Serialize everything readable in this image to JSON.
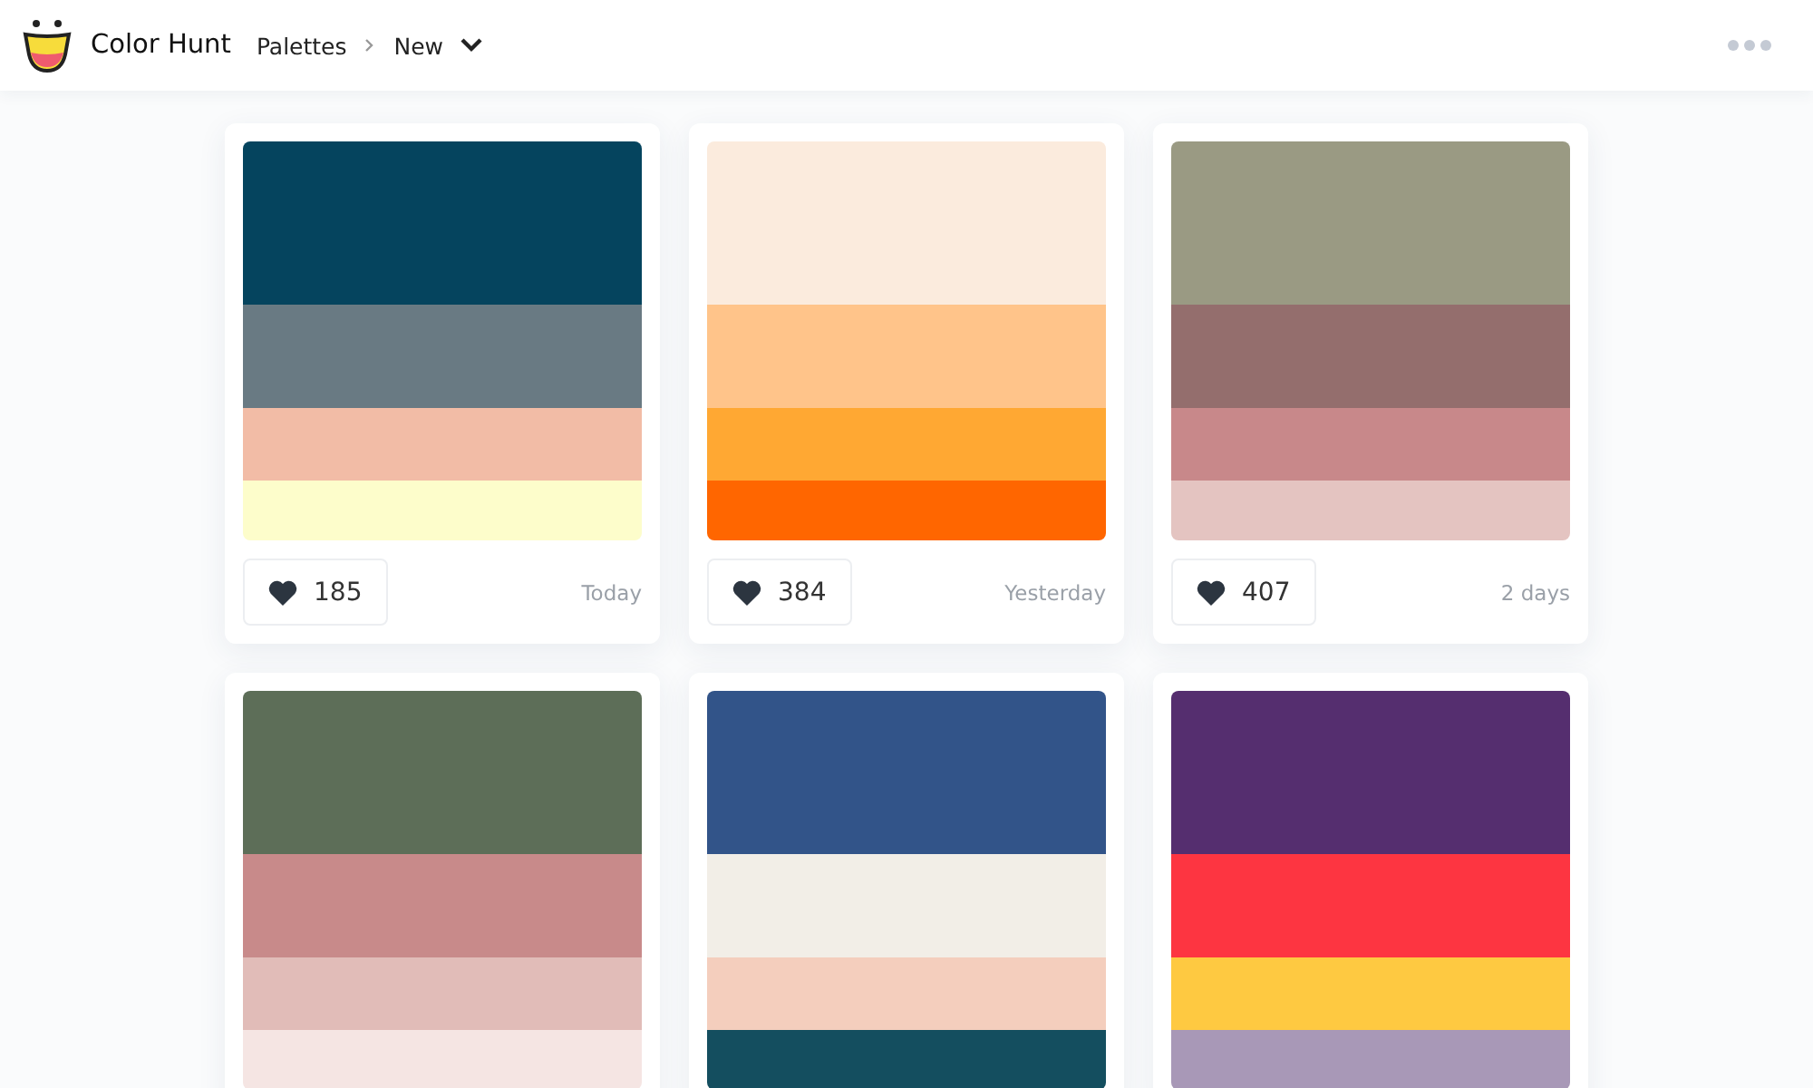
{
  "header": {
    "brand": "Color Hunt",
    "breadcrumb": [
      {
        "label": "Palettes"
      },
      {
        "label": "New"
      }
    ]
  },
  "palettes": [
    {
      "swatches": [
        {
          "color": "#05445e"
        },
        {
          "color": "#697a83"
        },
        {
          "color": "#f2bca6"
        },
        {
          "color": "#fdfdcb"
        }
      ],
      "likes": "185",
      "date": "Today"
    },
    {
      "swatches": [
        {
          "color": "#fbebdd"
        },
        {
          "color": "#ffc48a"
        },
        {
          "color": "#ffa833"
        },
        {
          "color": "#ff6600"
        }
      ],
      "likes": "384",
      "date": "Yesterday"
    },
    {
      "swatches": [
        {
          "color": "#9a9a83"
        },
        {
          "color": "#946e6d"
        },
        {
          "color": "#c8888a"
        },
        {
          "color": "#e4c4c1"
        }
      ],
      "likes": "407",
      "date": "2 days"
    },
    {
      "swatches": [
        {
          "color": "#5d6e58"
        },
        {
          "color": "#c88a8a"
        },
        {
          "color": "#e1bcb8"
        },
        {
          "color": "#f5e5e3"
        }
      ]
    },
    {
      "swatches": [
        {
          "color": "#325489"
        },
        {
          "color": "#f2eee7"
        },
        {
          "color": "#f4cebd"
        },
        {
          "color": "#144e5f"
        }
      ]
    },
    {
      "swatches": [
        {
          "color": "#552e6f"
        },
        {
          "color": "#fd3541"
        },
        {
          "color": "#fec941"
        },
        {
          "color": "#a898b7"
        }
      ]
    }
  ]
}
